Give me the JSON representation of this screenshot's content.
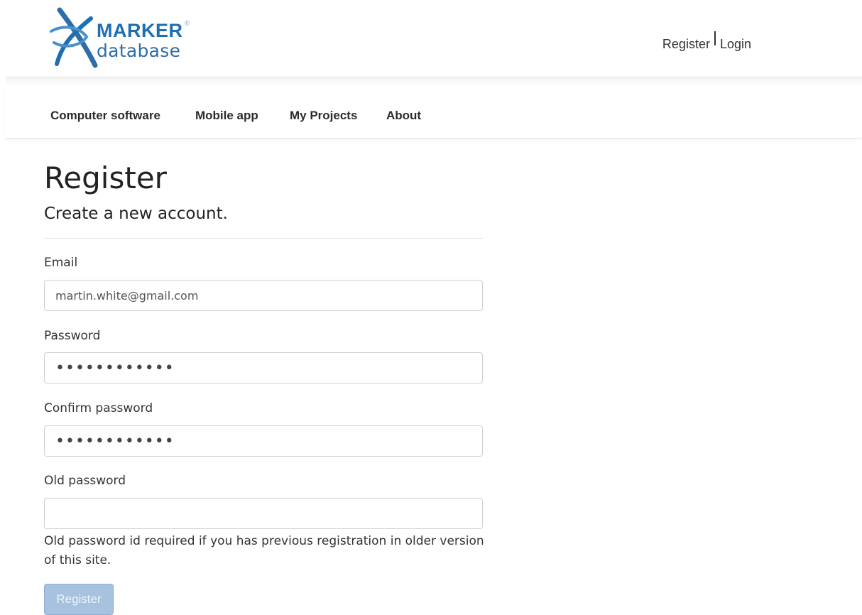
{
  "brand": {
    "name_top": "MARKER",
    "registered_mark": "®",
    "name_bottom": "database",
    "color": "#1e6fb2"
  },
  "header": {
    "register_link": "Register",
    "login_link": "Login"
  },
  "nav": {
    "items": [
      {
        "label": "Computer software"
      },
      {
        "label": "Mobile app"
      },
      {
        "label": "My Projects"
      },
      {
        "label": "About"
      }
    ]
  },
  "form": {
    "title": "Register",
    "subtitle": "Create a new account.",
    "email": {
      "label": "Email",
      "value": "martin.white@gmail.com"
    },
    "password": {
      "label": "Password",
      "value": "••••••••••••"
    },
    "confirm_password": {
      "label": "Confirm password",
      "value": "••••••••••••"
    },
    "old_password": {
      "label": "Old password",
      "value": ""
    },
    "help_text": "Old password id required if you has previous registration in older version of this site.",
    "submit_label": "Register",
    "submit_color": "#a7c2de"
  }
}
